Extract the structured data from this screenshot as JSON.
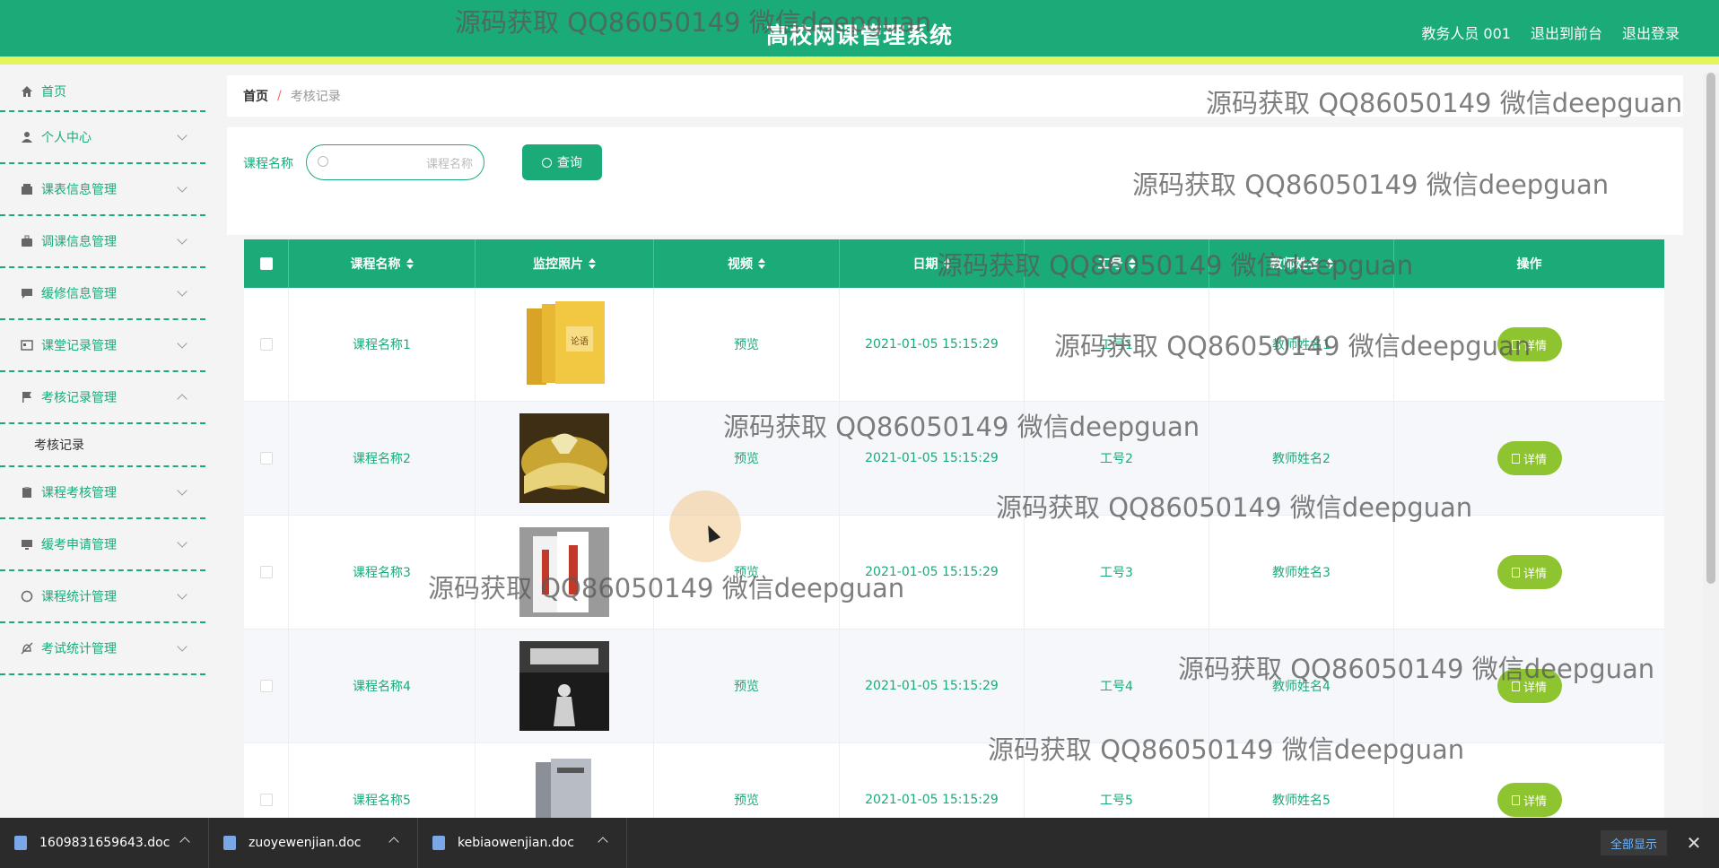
{
  "header": {
    "title": "高校网课管理系统",
    "user": "教务人员 001",
    "front_link": "退出到前台",
    "logout": "退出登录"
  },
  "sidebar": {
    "items": [
      {
        "label": "首页",
        "icon": "home-icon"
      },
      {
        "label": "个人中心",
        "icon": "user-icon"
      },
      {
        "label": "课表信息管理",
        "icon": "wallet-icon"
      },
      {
        "label": "调课信息管理",
        "icon": "briefcase-icon"
      },
      {
        "label": "缓修信息管理",
        "icon": "chat-icon"
      },
      {
        "label": "课堂记录管理",
        "icon": "card-icon"
      },
      {
        "label": "考核记录管理",
        "icon": "flag-icon",
        "expanded": true,
        "sub": "考核记录"
      },
      {
        "label": "课程考核管理",
        "icon": "clipboard-icon"
      },
      {
        "label": "缓考申请管理",
        "icon": "monitor-icon"
      },
      {
        "label": "课程统计管理",
        "icon": "compass-icon"
      },
      {
        "label": "考试统计管理",
        "icon": "bell-off-icon"
      }
    ]
  },
  "breadcrumb": {
    "home": "首页",
    "separator": "/",
    "current": "考核记录"
  },
  "search": {
    "label": "课程名称",
    "placeholder": "课程名称",
    "button": "查询"
  },
  "table": {
    "headers": [
      "课程名称",
      "监控照片",
      "视频",
      "日期",
      "工号",
      "教师姓名",
      "操作"
    ],
    "rows": [
      {
        "course": "课程名称1",
        "video": "预览",
        "date": "2021-01-05 15:15:29",
        "id": "工号1",
        "teacher": "教师姓名1",
        "action": "详情"
      },
      {
        "course": "课程名称2",
        "video": "预览",
        "date": "2021-01-05 15:15:29",
        "id": "工号2",
        "teacher": "教师姓名2",
        "action": "详情"
      },
      {
        "course": "课程名称3",
        "video": "预览",
        "date": "2021-01-05 15:15:29",
        "id": "工号3",
        "teacher": "教师姓名3",
        "action": "详情"
      },
      {
        "course": "课程名称4",
        "video": "预览",
        "date": "2021-01-05 15:15:29",
        "id": "工号4",
        "teacher": "教师姓名4",
        "action": "详情"
      },
      {
        "course": "课程名称5",
        "video": "预览",
        "date": "2021-01-05 15:15:29",
        "id": "工号5",
        "teacher": "教师姓名5",
        "action": "详情"
      }
    ]
  },
  "watermark": "源码获取 QQ86050149 微信deepguan",
  "downloads": {
    "files": [
      "1609831659643.doc",
      "zuoyewenjian.doc",
      "kebiaowenjian.doc"
    ],
    "show_all": "全部显示",
    "close": "✕"
  },
  "colors": {
    "primary": "#1aab78",
    "accent_bar": "#e4f55a",
    "detail_button": "#8ec430"
  }
}
